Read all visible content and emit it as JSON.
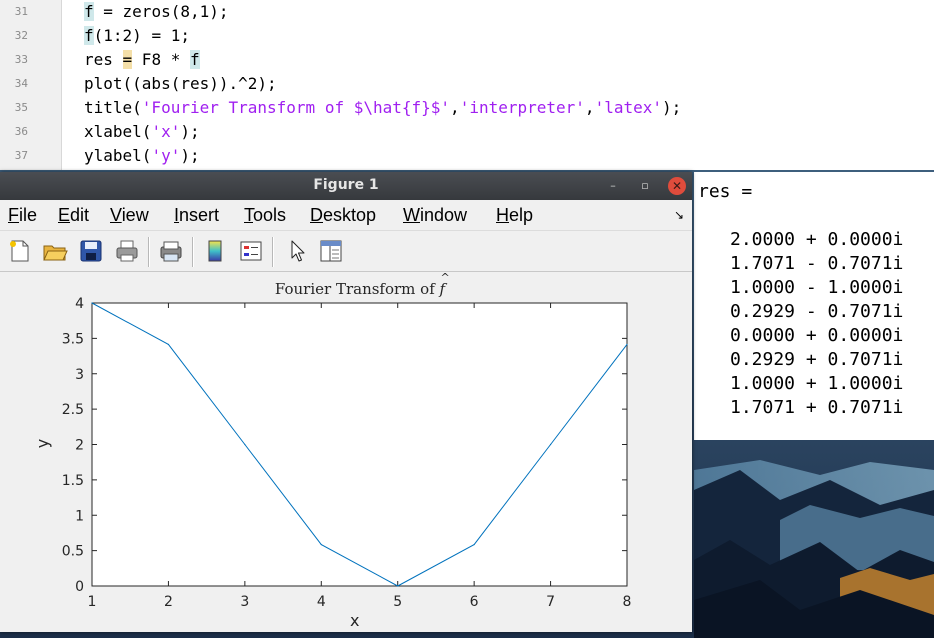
{
  "editor": {
    "lines": [
      {
        "num": "31",
        "parts": [
          {
            "t": "f",
            "c": "hl"
          },
          {
            "t": " = zeros(8,1);"
          }
        ]
      },
      {
        "num": "32",
        "parts": [
          {
            "t": "f",
            "c": "hl"
          },
          {
            "t": "(1:2) = 1;"
          }
        ]
      },
      {
        "num": "33",
        "parts": [
          {
            "t": "res "
          },
          {
            "t": "=",
            "c": "hl-eq"
          },
          {
            "t": " F8 * "
          },
          {
            "t": "f",
            "c": "hl"
          }
        ]
      },
      {
        "num": "34",
        "parts": [
          {
            "t": "plot((abs(res)).^2);"
          }
        ]
      },
      {
        "num": "35",
        "parts": [
          {
            "t": "title("
          },
          {
            "t": "'Fourier Transform of $\\hat{f}$'",
            "c": "str"
          },
          {
            "t": ","
          },
          {
            "t": "'interpreter'",
            "c": "str"
          },
          {
            "t": ","
          },
          {
            "t": "'latex'",
            "c": "str"
          },
          {
            "t": ");"
          }
        ]
      },
      {
        "num": "36",
        "parts": [
          {
            "t": "xlabel("
          },
          {
            "t": "'x'",
            "c": "str"
          },
          {
            "t": ");"
          }
        ]
      },
      {
        "num": "37",
        "parts": [
          {
            "t": "ylabel("
          },
          {
            "t": "'y'",
            "c": "str"
          },
          {
            "t": ");"
          }
        ]
      }
    ]
  },
  "command_window": {
    "label": "res =",
    "rows": [
      "2.0000 + 0.0000i",
      "1.7071 - 0.7071i",
      "1.0000 - 1.0000i",
      "0.2929 - 0.7071i",
      "0.0000 + 0.0000i",
      "0.2929 + 0.7071i",
      "1.0000 + 1.0000i",
      "1.7071 + 0.7071i"
    ]
  },
  "figure": {
    "title": "Figure 1",
    "window_buttons": {
      "minimize": "–",
      "maximize": "▫",
      "close": "✕"
    },
    "dock_glyph": "↘",
    "menu": [
      {
        "u": "F",
        "rest": "ile"
      },
      {
        "u": "E",
        "rest": "dit"
      },
      {
        "u": "V",
        "rest": "iew"
      },
      {
        "u": "I",
        "rest": "nsert"
      },
      {
        "u": "T",
        "rest": "ools"
      },
      {
        "u": "D",
        "rest": "esktop"
      },
      {
        "u": "W",
        "rest": "indow"
      },
      {
        "u": "H",
        "rest": "elp"
      }
    ],
    "toolbar_icons": [
      "new-file-icon",
      "open-folder-icon",
      "save-icon",
      "print-icon",
      "print-preview-icon",
      "colorbar-icon",
      "legend-icon",
      "cursor-icon",
      "property-editor-icon"
    ]
  },
  "chart_data": {
    "type": "line",
    "title_prefix": "Fourier Transform of ",
    "title_symbol": "f",
    "xlabel": "x",
    "ylabel": "y",
    "x": [
      1,
      2,
      3,
      4,
      5,
      6,
      7,
      8
    ],
    "series": [
      {
        "values": [
          4,
          3.4142,
          2,
          0.5858,
          0,
          0.5858,
          2,
          3.4142
        ],
        "color": "#0072bd"
      }
    ],
    "xlim": [
      1,
      8
    ],
    "ylim": [
      0,
      4
    ],
    "xticks": [
      "1",
      "2",
      "3",
      "4",
      "5",
      "6",
      "7",
      "8"
    ],
    "yticks": [
      "0",
      "0.5",
      "1",
      "1.5",
      "2",
      "2.5",
      "3",
      "3.5",
      "4"
    ],
    "grid": false
  }
}
